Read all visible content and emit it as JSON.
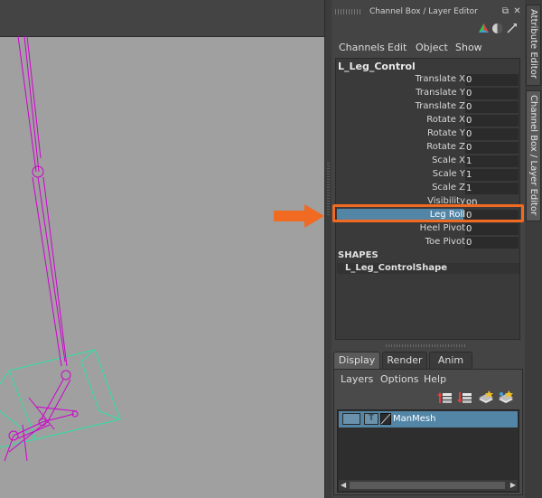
{
  "panel": {
    "title": "Channel Box / Layer Editor",
    "menu": [
      "Channels",
      "Edit",
      "Object",
      "Show"
    ]
  },
  "channel_box": {
    "node_name": "L_Leg_Control",
    "attributes": [
      {
        "label": "Translate X",
        "value": "0"
      },
      {
        "label": "Translate Y",
        "value": "0"
      },
      {
        "label": "Translate Z",
        "value": "0"
      },
      {
        "label": "Rotate X",
        "value": "0"
      },
      {
        "label": "Rotate Y",
        "value": "0"
      },
      {
        "label": "Rotate Z",
        "value": "0"
      },
      {
        "label": "Scale X",
        "value": "1"
      },
      {
        "label": "Scale Y",
        "value": "1"
      },
      {
        "label": "Scale Z",
        "value": "1"
      },
      {
        "label": "Visibility",
        "value": "on"
      },
      {
        "label": "Leg Roll",
        "value": "0",
        "selected": true
      },
      {
        "label": "Heel Pivot",
        "value": "0"
      },
      {
        "label": "Toe Pivot",
        "value": "0"
      }
    ],
    "shapes_header": "SHAPES",
    "shape_name": "L_Leg_ControlShape"
  },
  "layer_editor": {
    "tabs": [
      "Display",
      "Render",
      "Anim"
    ],
    "active_tab": "Display",
    "menu": [
      "Layers",
      "Options",
      "Help"
    ],
    "layer": {
      "visibility": "",
      "type": "T",
      "name": "ManMesh"
    }
  },
  "side_tabs": [
    "Attribute Editor",
    "Channel Box / Layer Editor"
  ],
  "colors": {
    "highlight": "#f06a22",
    "selection": "#5285a6",
    "rig_wire": "#d000d0",
    "bbox_wire": "#30e0a0"
  },
  "icons": {
    "float": "float-panel-icon",
    "close": "close-icon",
    "dock": "dock-icon",
    "sphere": "sphere-icon",
    "pin": "pin-icon"
  }
}
